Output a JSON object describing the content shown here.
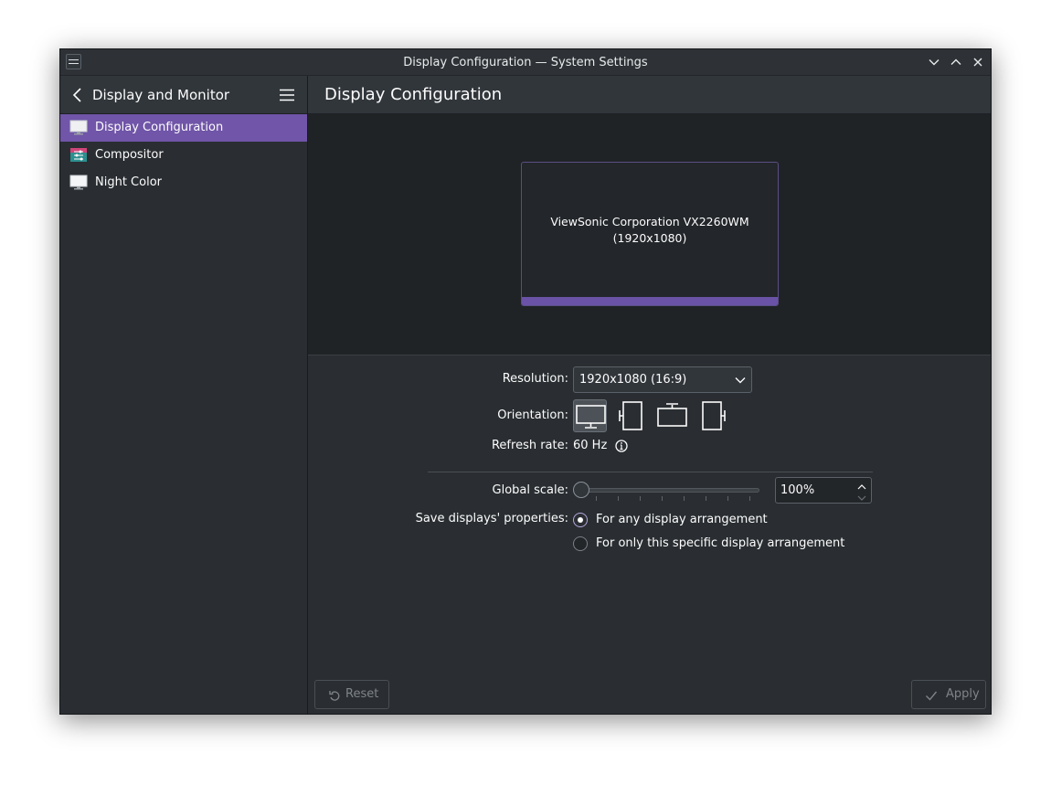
{
  "window": {
    "title": "Display Configuration — System Settings"
  },
  "sidebar": {
    "title": "Display and Monitor",
    "items": [
      {
        "label": "Display Configuration",
        "icon": "monitor-icon",
        "selected": true
      },
      {
        "label": "Compositor",
        "icon": "compositor-icon",
        "selected": false
      },
      {
        "label": "Night Color",
        "icon": "night-color-icon",
        "selected": false
      }
    ]
  },
  "main": {
    "title": "Display Configuration",
    "monitor": {
      "name": "ViewSonic Corporation VX2260WM",
      "resolution": "(1920x1080)"
    },
    "resolution": {
      "label": "Resolution:",
      "value": "1920x1080 (16:9)"
    },
    "orientation": {
      "label": "Orientation:",
      "selected": "landscape",
      "options": [
        "landscape",
        "rotate-left",
        "upside-down",
        "rotate-right"
      ]
    },
    "refresh_rate": {
      "label": "Refresh rate:",
      "value": "60 Hz"
    },
    "global_scale": {
      "label": "Global scale:",
      "value": "100%",
      "level_percent": 100
    },
    "save_properties": {
      "label": "Save displays' properties:",
      "options": [
        {
          "label": "For any display arrangement",
          "checked": true
        },
        {
          "label": "For only this specific display arrangement",
          "checked": false
        }
      ]
    }
  },
  "footer": {
    "reset_label": "Reset",
    "apply_label": "Apply"
  },
  "colors": {
    "accent": "#7055a8",
    "background": "#2a2e32",
    "header": "#31363b",
    "preview": "#202326"
  }
}
